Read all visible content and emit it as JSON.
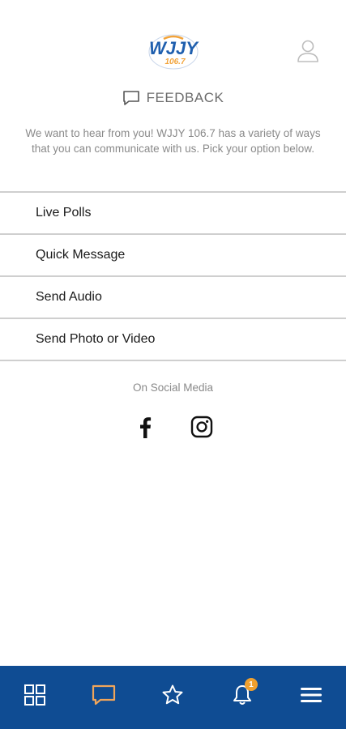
{
  "header": {
    "logo": {
      "name": "wjjy-logo",
      "text_main": "WJJY",
      "text_freq": "106.7",
      "colors": {
        "primary": "#1f5fae",
        "accent": "#f2a33a"
      }
    },
    "account_icon": "user-icon"
  },
  "page": {
    "title_icon": "chat-icon",
    "title": "FEEDBACK",
    "intro": "We want to hear from you! WJJY 106.7 has a variety of ways that you can communicate with us. Pick your option below."
  },
  "options": [
    {
      "label": "Live Polls"
    },
    {
      "label": "Quick Message"
    },
    {
      "label": "Send Audio"
    },
    {
      "label": "Send Photo or Video"
    }
  ],
  "social": {
    "title": "On Social Media",
    "icons": [
      "facebook-icon",
      "instagram-icon"
    ]
  },
  "bottom_nav": {
    "background": "#0f4c93",
    "active_color": "#f0a55a",
    "items": [
      {
        "icon": "grid-icon",
        "active": false
      },
      {
        "icon": "chat-icon",
        "active": true
      },
      {
        "icon": "star-icon",
        "active": false
      },
      {
        "icon": "bell-icon",
        "active": false,
        "badge": "1"
      },
      {
        "icon": "menu-icon",
        "active": false
      }
    ]
  }
}
